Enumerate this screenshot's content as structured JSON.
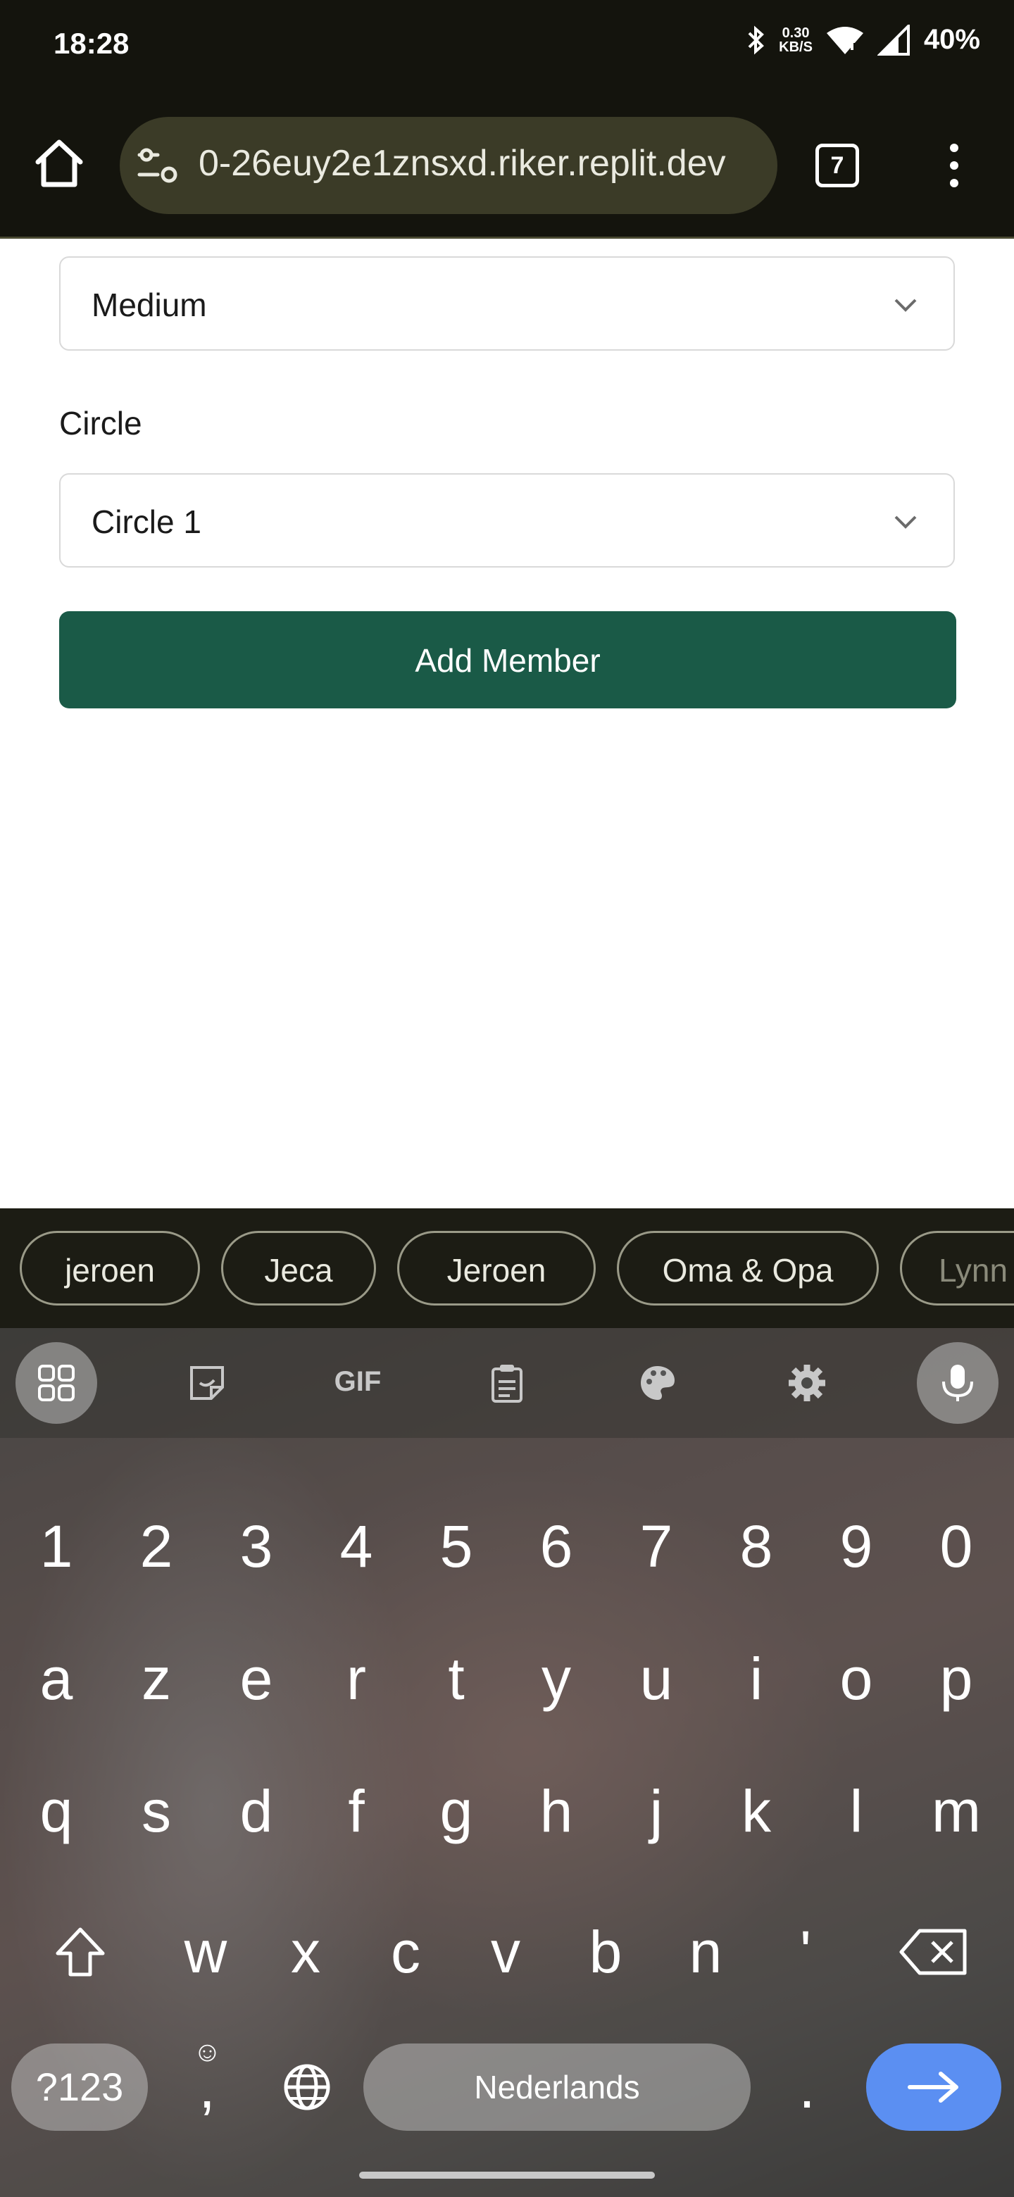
{
  "status_bar": {
    "time": "18:28",
    "net_speed_value": "0.30",
    "net_speed_unit": "KB/S",
    "battery": "40%"
  },
  "browser": {
    "url": "0-26euy2e1znsxd.riker.replit.dev",
    "tab_count": "7"
  },
  "form": {
    "size_select_value": "Medium",
    "circle_label": "Circle",
    "circle_select_value": "Circle 1",
    "submit_label": "Add Member"
  },
  "keyboard": {
    "suggestions": [
      "jeroen",
      "Jeca",
      "Jeroen",
      "Oma & Opa",
      "Lynn"
    ],
    "toolbar_icons": [
      "apps-grid-icon",
      "sticker-icon",
      "gif-icon",
      "clipboard-icon",
      "palette-icon",
      "settings-gear-icon",
      "microphone-icon"
    ],
    "gif_label": "GIF",
    "row_numbers": [
      "1",
      "2",
      "3",
      "4",
      "5",
      "6",
      "7",
      "8",
      "9",
      "0"
    ],
    "row1": [
      "a",
      "z",
      "e",
      "r",
      "t",
      "y",
      "u",
      "i",
      "o",
      "p"
    ],
    "row2": [
      "q",
      "s",
      "d",
      "f",
      "g",
      "h",
      "j",
      "k",
      "l",
      "m"
    ],
    "row3": [
      "w",
      "x",
      "c",
      "v",
      "b",
      "n",
      "'"
    ],
    "symbols_label": "?123",
    "comma": ",",
    "space_label": "Nederlands",
    "period": ".",
    "accent_color": "#5b8ff2"
  }
}
